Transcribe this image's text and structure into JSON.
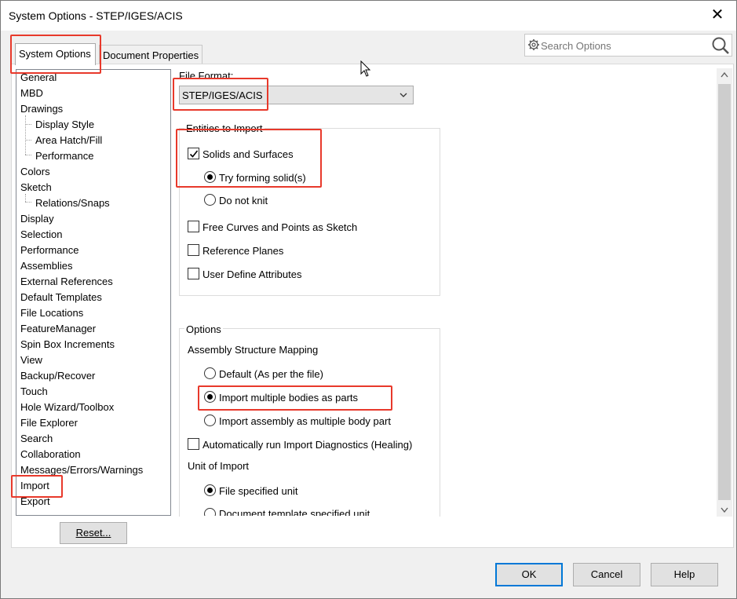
{
  "window": {
    "title": "System Options - STEP/IGES/ACIS",
    "close_glyph": "✕"
  },
  "tabs": [
    {
      "label": "System Options",
      "active": true
    },
    {
      "label": "Document Properties",
      "active": false
    }
  ],
  "search": {
    "placeholder": "Search Options",
    "icon_left": "gear-icon",
    "icon_right": "search-icon"
  },
  "tree": {
    "items": [
      {
        "label": "General",
        "level": 0
      },
      {
        "label": "MBD",
        "level": 0
      },
      {
        "label": "Drawings",
        "level": 0
      },
      {
        "label": "Display Style",
        "level": 1
      },
      {
        "label": "Area Hatch/Fill",
        "level": 1
      },
      {
        "label": "Performance",
        "level": 1
      },
      {
        "label": "Colors",
        "level": 0
      },
      {
        "label": "Sketch",
        "level": 0
      },
      {
        "label": "Relations/Snaps",
        "level": 1
      },
      {
        "label": "Display",
        "level": 0
      },
      {
        "label": "Selection",
        "level": 0
      },
      {
        "label": "Performance",
        "level": 0
      },
      {
        "label": "Assemblies",
        "level": 0
      },
      {
        "label": "External References",
        "level": 0
      },
      {
        "label": "Default Templates",
        "level": 0
      },
      {
        "label": "File Locations",
        "level": 0
      },
      {
        "label": "FeatureManager",
        "level": 0
      },
      {
        "label": "Spin Box Increments",
        "level": 0
      },
      {
        "label": "View",
        "level": 0
      },
      {
        "label": "Backup/Recover",
        "level": 0
      },
      {
        "label": "Touch",
        "level": 0
      },
      {
        "label": "Hole Wizard/Toolbox",
        "level": 0
      },
      {
        "label": "File Explorer",
        "level": 0
      },
      {
        "label": "Search",
        "level": 0
      },
      {
        "label": "Collaboration",
        "level": 0
      },
      {
        "label": "Messages/Errors/Warnings",
        "level": 0
      },
      {
        "label": "Import",
        "level": 0,
        "selected": true
      },
      {
        "label": "Export",
        "level": 0
      }
    ],
    "reset_label": "Reset..."
  },
  "content": {
    "file_format_label": "File Format:",
    "file_format_value": "STEP/IGES/ACIS",
    "entities_group": {
      "label": "Entities to Import",
      "solids_surfaces": {
        "label": "Solids and Surfaces",
        "checked": true
      },
      "try_forming": {
        "label": "Try forming solid(s)",
        "selected": true
      },
      "do_not_knit": {
        "label": "Do not knit",
        "selected": false
      },
      "free_curves": {
        "label": "Free Curves and Points as Sketch",
        "checked": false
      },
      "reference_planes": {
        "label": "Reference Planes",
        "checked": false
      },
      "user_attributes": {
        "label": "User Define Attributes",
        "checked": false
      }
    },
    "options_group": {
      "label": "Options",
      "mapping_label": "Assembly Structure Mapping",
      "default_file": {
        "label": "Default (As per the file)",
        "selected": false
      },
      "multiple_bodies": {
        "label": "Import multiple bodies as parts",
        "selected": true
      },
      "assembly_multibody": {
        "label": "Import assembly as multiple body part",
        "selected": false
      },
      "auto_diagnostics": {
        "label": "Automatically run Import Diagnostics (Healing)",
        "checked": false
      },
      "unit_label": "Unit of Import",
      "file_unit": {
        "label": "File specified unit",
        "selected": true
      },
      "doc_template_unit": {
        "label": "Document template specified unit",
        "selected": false
      }
    }
  },
  "buttons": {
    "ok": "OK",
    "cancel": "Cancel",
    "help": "Help"
  },
  "colors": {
    "highlight": "#e8392b",
    "primary_border": "#0078d7"
  }
}
